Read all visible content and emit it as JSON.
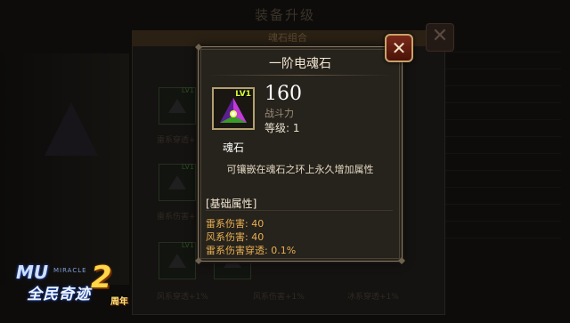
{
  "background": {
    "title": "装备升级",
    "panel_header": "魂石组合",
    "slot_level": "LV1",
    "slot_captions": [
      "雷系穿透+1%",
      "雷系伤害+1%",
      "风系穿透+1%",
      "风系伤害+1%",
      "冰系穿透+1%"
    ]
  },
  "logo": {
    "mu": "MU",
    "miracle": "MIRACLE",
    "main": "全民奇迹",
    "two": "2",
    "anniv": "周年"
  },
  "tooltip": {
    "title": "一阶电魂石",
    "icon_level": "LV1",
    "icon": "triangle-soul-stone-icon",
    "power": "160",
    "power_label": "战斗力",
    "level": "等级: 1",
    "item_name": "魂石",
    "description": "可镶嵌在魂石之环上永久增加属性",
    "section_title": "[基础属性]",
    "attributes": [
      "雷系伤害: 40",
      "风系伤害: 40",
      "雷系伤害穿透: 0.1%"
    ]
  },
  "close_button": {
    "icon": "close-x-icon",
    "glyph": "✕"
  },
  "colors": {
    "accent_gold": "#b3a070",
    "attribute_text": "#e8b050",
    "level_badge": "#d6ff3a",
    "close_red": "#7a2a1a"
  }
}
